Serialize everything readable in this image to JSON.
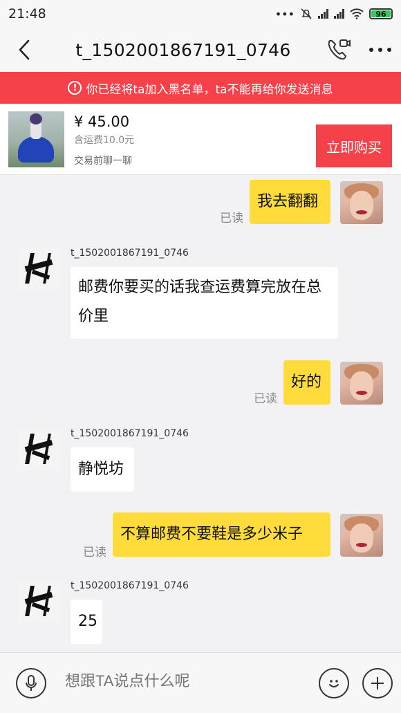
{
  "status_bar": {
    "time": "21:48",
    "dots": "•••",
    "battery": "96"
  },
  "header": {
    "title": "t_1502001867191_0746"
  },
  "banner": {
    "text": "你已经将ta加入黑名单，ta不能再给你发送消息"
  },
  "product": {
    "price": "¥ 45.00",
    "shipping": "含运费10.0元",
    "chat_hint": "交易前聊一聊",
    "buy_label": "立即购买"
  },
  "messages": [
    {
      "from": "me",
      "text": "我去翻翻",
      "read": "已读"
    },
    {
      "from": "other",
      "sender": "t_1502001867191_0746",
      "text": "邮费你要买的话我查运费算完放在总价里"
    },
    {
      "from": "me",
      "text": "好的",
      "read": "已读"
    },
    {
      "from": "other",
      "sender": "t_1502001867191_0746",
      "text": "静悦坊"
    },
    {
      "from": "me",
      "text": "不算邮费不要鞋是多少米子",
      "read": "已读"
    },
    {
      "from": "other",
      "sender": "t_1502001867191_0746",
      "text": "25"
    }
  ],
  "input": {
    "placeholder": "想跟TA说点什么呢"
  },
  "colors": {
    "accent_red": "#f5424a",
    "my_bubble": "#ffdc3c",
    "battery_green": "#34c759"
  },
  "icons": [
    "back-arrow-icon",
    "video-call-icon",
    "more-icon",
    "warning-icon",
    "microphone-icon",
    "emoji-icon",
    "plus-icon"
  ]
}
